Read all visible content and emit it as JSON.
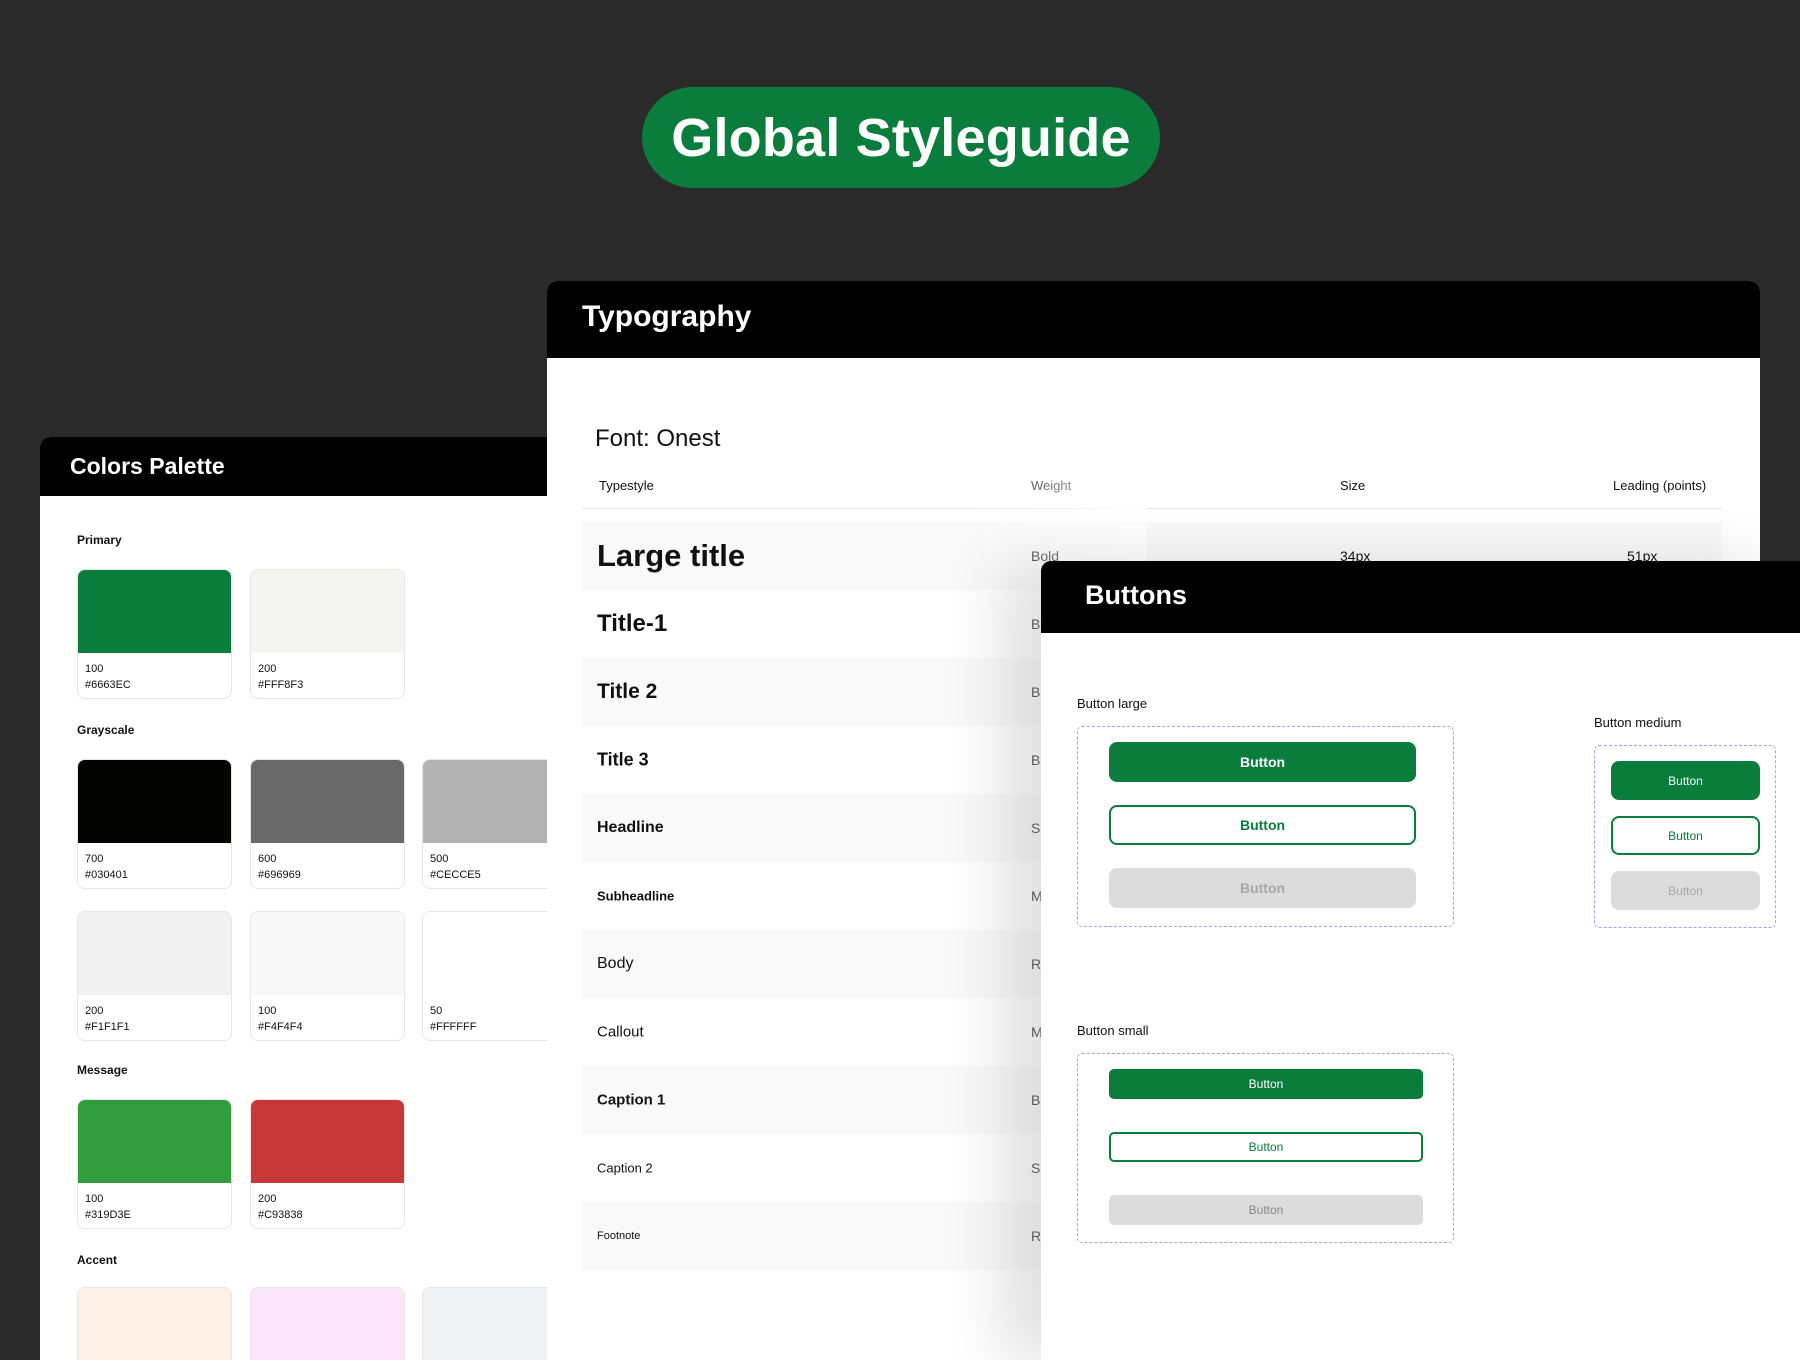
{
  "header": {
    "title": "Global Styleguide"
  },
  "colors_panel": {
    "title": "Colors Palette",
    "sections": {
      "primary": "Primary",
      "grayscale": "Grayscale",
      "message": "Message",
      "accent": "Accent"
    },
    "primary": [
      {
        "level": "100",
        "hex": "#6663EC",
        "color": "#0a7d3c"
      },
      {
        "level": "200",
        "hex": "#FFF8F3",
        "color": "#f5f5f3"
      }
    ],
    "grayscale": [
      {
        "level": "700",
        "hex": "#030401",
        "color": "#030401"
      },
      {
        "level": "600",
        "hex": "#696969",
        "color": "#696969"
      },
      {
        "level": "500",
        "hex": "#CECCE5",
        "color": "#b3b3b3"
      },
      {
        "level": "200",
        "hex": "#F1F1F1",
        "color": "#f1f1f1"
      },
      {
        "level": "100",
        "hex": "#F4F4F4",
        "color": "#f8f8f8"
      },
      {
        "level": "50",
        "hex": "#FFFFFF",
        "color": "#ffffff"
      }
    ],
    "message": [
      {
        "level": "100",
        "hex": "#319D3E",
        "color": "#319d3e"
      },
      {
        "level": "200",
        "hex": "#C93838",
        "color": "#c93838"
      }
    ],
    "accent": [
      {
        "color": "#fdf1e8"
      },
      {
        "color": "#fbe5fb"
      },
      {
        "color": "#f1f2f4"
      }
    ]
  },
  "typography_panel": {
    "title": "Typography",
    "font": "Font: Onest",
    "columns": {
      "typestyle": "Typestyle",
      "weight": "Weight",
      "size": "Size",
      "leading": "Leading (points)"
    },
    "rows": [
      {
        "name": "Large title",
        "weight": "Bold",
        "size": "34px",
        "leading": "51px"
      },
      {
        "name": "Title-1",
        "weight": "B"
      },
      {
        "name": "Title 2",
        "weight": "B"
      },
      {
        "name": "Title 3",
        "weight": "B"
      },
      {
        "name": "Headline",
        "weight": "S"
      },
      {
        "name": "Subheadline",
        "weight": "M"
      },
      {
        "name": "Body",
        "weight": "R"
      },
      {
        "name": "Callout",
        "weight": "M"
      },
      {
        "name": "Caption 1",
        "weight": "B"
      },
      {
        "name": "Caption 2",
        "weight": "S"
      },
      {
        "name": "Footnote",
        "weight": "R"
      }
    ]
  },
  "buttons_panel": {
    "title": "Buttons",
    "large_label": "Button large",
    "medium_label": "Button medium",
    "small_label": "Button small",
    "button_text": "Button"
  },
  "colors": {
    "brand_green": "#0a7d3c",
    "dashed_border": "#a99cf5"
  }
}
